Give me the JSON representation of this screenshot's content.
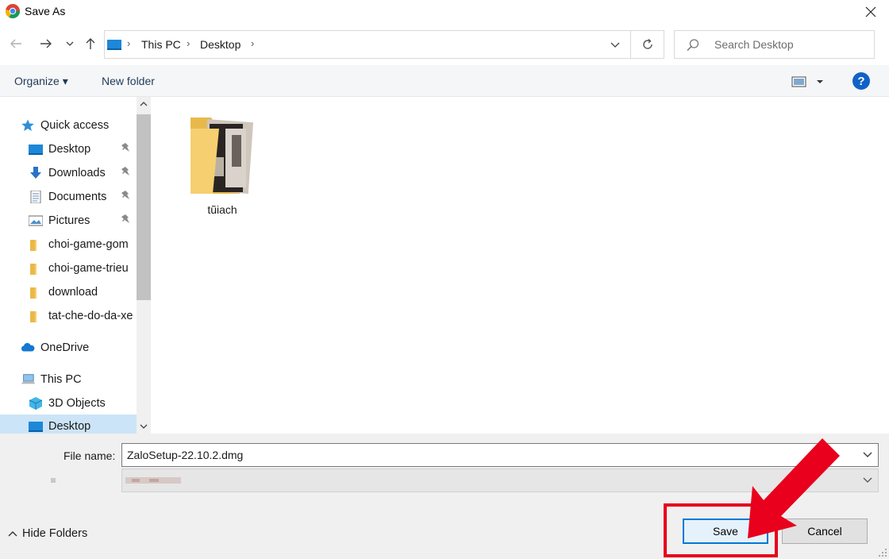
{
  "window": {
    "title": "Save As",
    "close_glyph": "✕"
  },
  "nav": {
    "back_glyph": "←",
    "forward_glyph": "→",
    "recent_glyph": "⌄",
    "up_glyph": "↑",
    "breadcrumb": [
      "This PC",
      "Desktop"
    ],
    "breadcrumb_sep": "›",
    "search_placeholder": "Search Desktop"
  },
  "toolbar": {
    "organize_label": "Organize ▾",
    "new_folder_label": "New folder",
    "help_label": "?"
  },
  "sidebar": {
    "items": [
      {
        "label": "Quick access",
        "icon": "star-icon",
        "pinned": false,
        "level": "top"
      },
      {
        "label": "Desktop",
        "icon": "desktop-icon",
        "pinned": true,
        "level": "child"
      },
      {
        "label": "Downloads",
        "icon": "download-arrow-icon",
        "pinned": true,
        "level": "child"
      },
      {
        "label": "Documents",
        "icon": "document-icon",
        "pinned": true,
        "level": "child"
      },
      {
        "label": "Pictures",
        "icon": "picture-icon",
        "pinned": true,
        "level": "child"
      },
      {
        "label": "choi-game-gom",
        "icon": "folder-icon",
        "pinned": false,
        "level": "child"
      },
      {
        "label": "choi-game-trieu",
        "icon": "folder-icon",
        "pinned": false,
        "level": "child"
      },
      {
        "label": "download",
        "icon": "folder-icon",
        "pinned": false,
        "level": "child"
      },
      {
        "label": "tat-che-do-da-xe",
        "icon": "folder-icon",
        "pinned": false,
        "level": "child"
      },
      {
        "label": "OneDrive",
        "icon": "cloud-icon",
        "pinned": false,
        "level": "top"
      },
      {
        "label": "This PC",
        "icon": "computer-icon",
        "pinned": false,
        "level": "top"
      },
      {
        "label": "3D Objects",
        "icon": "cube-icon",
        "pinned": false,
        "level": "child"
      },
      {
        "label": "Desktop",
        "icon": "desktop-icon",
        "pinned": false,
        "level": "child",
        "selected": true
      }
    ],
    "pin_glyph": "📌"
  },
  "content": {
    "items": [
      {
        "label": "tũiach",
        "icon": "folder-with-images-icon"
      }
    ]
  },
  "fields": {
    "file_name_label": "File name:",
    "file_name_value": "ZaloSetup-22.10.2.dmg",
    "save_as_type_value": ""
  },
  "footer": {
    "hide_folders_label": "Hide Folders",
    "save_label": "Save",
    "cancel_label": "Cancel"
  },
  "colors": {
    "accent": "#0078d7",
    "selected_bg": "#cce4f7",
    "annotation": "#e8001c",
    "folder": "#f6d070"
  }
}
